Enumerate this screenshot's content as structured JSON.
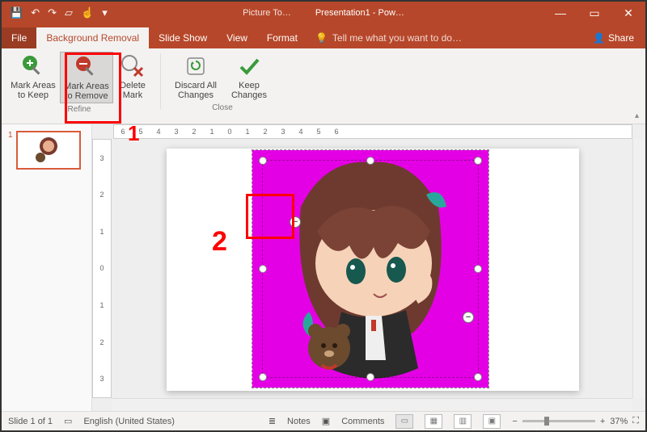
{
  "title": {
    "context": "Picture To…",
    "doc": "Presentation1 - Pow…"
  },
  "qat": {
    "save": "💾",
    "undo": "↶",
    "redo": "↷",
    "start": "▱",
    "touch": "☝",
    "dd1": "▾"
  },
  "window": {
    "min": "—",
    "max": "▭",
    "close": "✕"
  },
  "tabs": {
    "file": "File",
    "bgremoval": "Background Removal",
    "slideshow": "Slide Show",
    "view": "View",
    "format": "Format",
    "tell_icon": "💡",
    "tell": "Tell me what you want to do…",
    "share_icon": "👤",
    "share": "Share"
  },
  "ribbon": {
    "refine": {
      "label": "Refine",
      "keep": {
        "l1": "Mark Areas",
        "l2": "to Keep"
      },
      "remove": {
        "l1": "Mark Areas",
        "l2": "to Remove"
      },
      "delete": {
        "l1": "Delete",
        "l2": "Mark"
      }
    },
    "close": {
      "label": "Close",
      "discard": {
        "l1": "Discard All",
        "l2": "Changes"
      },
      "keepch": {
        "l1": "Keep",
        "l2": "Changes"
      }
    }
  },
  "ruler_h": [
    "6",
    "5",
    "4",
    "3",
    "2",
    "1",
    "0",
    "1",
    "2",
    "3",
    "4",
    "5",
    "6"
  ],
  "ruler_v": [
    "3",
    "2",
    "1",
    "0",
    "1",
    "2",
    "3"
  ],
  "annotations": {
    "one": "1",
    "two": "2"
  },
  "thumbs": {
    "n1": "1"
  },
  "status": {
    "slide": "Slide 1 of 1",
    "spell": "▭",
    "lang": "English (United States)",
    "notes_icon": "≣",
    "notes": "Notes",
    "comments_icon": "▣",
    "comments": "Comments",
    "zoom_out": "−",
    "zoom_in": "+",
    "zoom": "37%",
    "fit": "⛶"
  },
  "markers": {
    "minus": "−"
  }
}
